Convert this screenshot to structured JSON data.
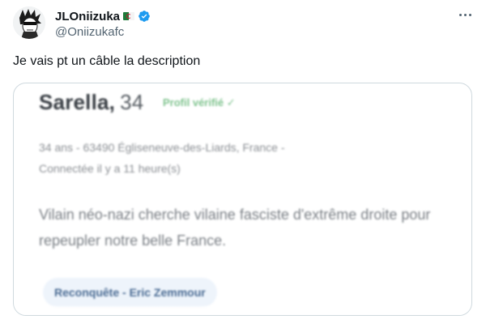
{
  "tweet": {
    "author": {
      "display_name": "JLOniizuka",
      "flag_icon": "algeria-flag-icon",
      "verified_icon": "verified-badge-icon",
      "handle": "@Oniizukafc",
      "avatar": "manga-character-avatar"
    },
    "more_icon": "more-options-icon",
    "text": "Je vais pt un câble la description"
  },
  "media": {
    "profile_name": "Sarella,",
    "profile_age": "34",
    "profile_badge": "Profil vérifié ✓",
    "meta_line1": "34 ans - 63490 Égliseneuve-des-Liards, France -",
    "meta_line2": "Connectée il y a 11 heure(s)",
    "description": "Vilain néo-nazi cherche vilaine fasciste d'extrême droite pour repeupler notre belle France.",
    "tag": "Reconquête - Eric Zemmour"
  },
  "colors": {
    "text_primary": "#0f1419",
    "text_secondary": "#536471",
    "verified_blue": "#1d9bf0",
    "border": "#cfd9de",
    "badge_green": "#7fc38e"
  }
}
